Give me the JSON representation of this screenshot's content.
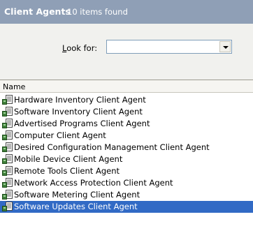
{
  "header": {
    "title": "Client Agents",
    "count": "10 items found"
  },
  "search": {
    "label_accesskey": "L",
    "label_rest": "ook for:",
    "value": "",
    "icon": "chevron-down-icon"
  },
  "list": {
    "column_name": "Name",
    "item_icon": "client-agent-icon",
    "items": [
      {
        "label": "Hardware Inventory Client Agent"
      },
      {
        "label": "Software Inventory Client Agent"
      },
      {
        "label": "Advertised Programs Client Agent"
      },
      {
        "label": "Computer Client Agent"
      },
      {
        "label": "Desired Configuration Management Client Agent"
      },
      {
        "label": "Mobile Device Client Agent"
      },
      {
        "label": "Remote Tools Client Agent"
      },
      {
        "label": "Network Access Protection Client Agent"
      },
      {
        "label": "Software Metering Client Agent"
      },
      {
        "label": "Software Updates Client Agent",
        "selected": true
      }
    ]
  },
  "colors": {
    "header_bg": "#8f9fb6",
    "search_bg": "#f1f1ee",
    "selection_bg": "#316ac5"
  }
}
